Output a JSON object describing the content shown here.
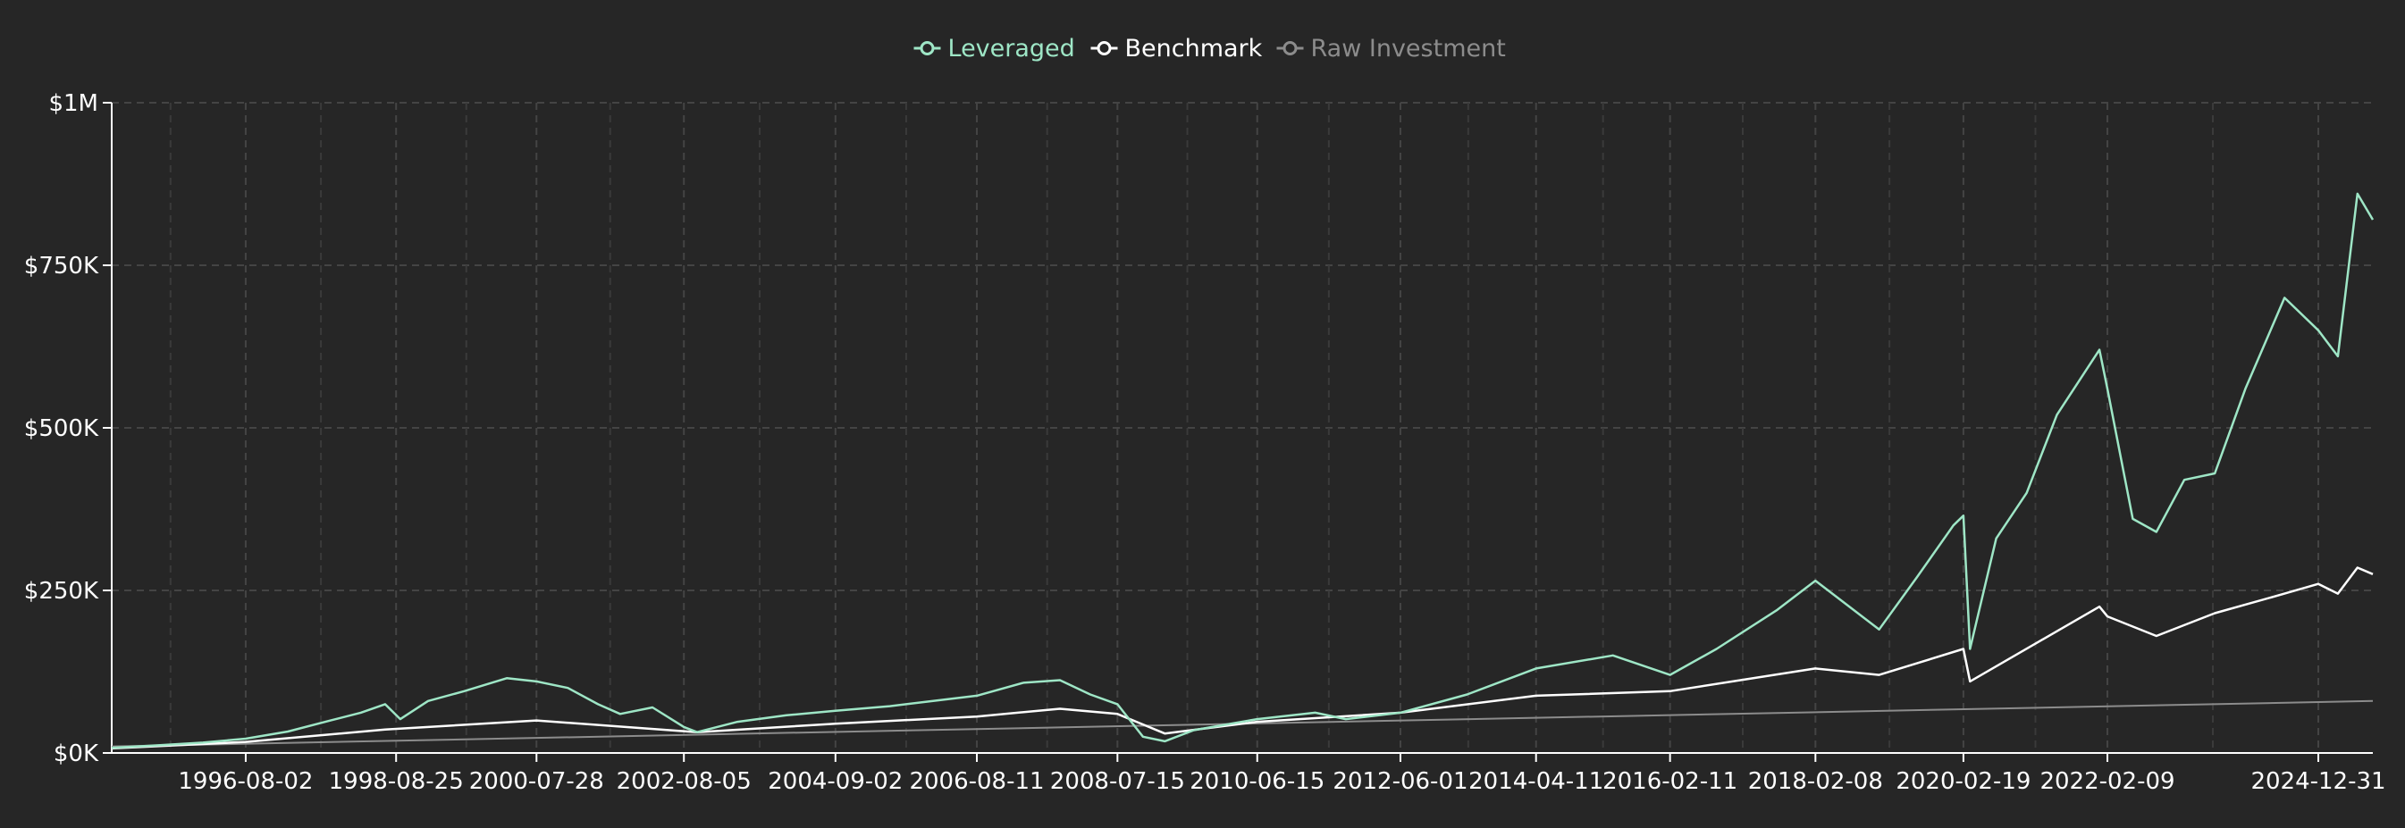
{
  "chart_data": {
    "type": "line",
    "title": "",
    "xlabel": "",
    "ylabel": "",
    "ylim": [
      0,
      1000000
    ],
    "grid": true,
    "legend_position": "top-center",
    "x_range": [
      "1994-10-01",
      "2025-09-30"
    ],
    "x_tick_labels": [
      "1996-08-02",
      "1998-08-25",
      "2000-07-28",
      "2002-08-05",
      "2004-09-02",
      "2006-08-11",
      "2008-07-15",
      "2010-06-15",
      "2012-06-01",
      "2014-04-11",
      "2016-02-11",
      "2018-02-08",
      "2020-02-19",
      "2022-02-09",
      "2024-12-31"
    ],
    "y_ticks": [
      {
        "value": 0,
        "label": "$0K"
      },
      {
        "value": 250000,
        "label": "$250K"
      },
      {
        "value": 500000,
        "label": "$500K"
      },
      {
        "value": 750000,
        "label": "$750K"
      },
      {
        "value": 1000000,
        "label": "$1M"
      }
    ],
    "series": [
      {
        "name": "Leveraged",
        "color": "#9ee6c6",
        "points": [
          [
            "1994-10-01",
            8000
          ],
          [
            "1995-06-01",
            12000
          ],
          [
            "1996-01-01",
            16000
          ],
          [
            "1996-08-02",
            22000
          ],
          [
            "1997-03-01",
            33000
          ],
          [
            "1997-10-01",
            50000
          ],
          [
            "1998-03-01",
            62000
          ],
          [
            "1998-07-01",
            75000
          ],
          [
            "1998-09-15",
            52000
          ],
          [
            "1999-02-01",
            80000
          ],
          [
            "1999-08-01",
            95000
          ],
          [
            "2000-03-01",
            115000
          ],
          [
            "2000-07-28",
            110000
          ],
          [
            "2001-01-01",
            100000
          ],
          [
            "2001-06-01",
            75000
          ],
          [
            "2001-09-20",
            60000
          ],
          [
            "2002-03-01",
            70000
          ],
          [
            "2002-08-05",
            40000
          ],
          [
            "2002-10-10",
            32000
          ],
          [
            "2003-05-01",
            48000
          ],
          [
            "2004-01-01",
            58000
          ],
          [
            "2004-09-02",
            65000
          ],
          [
            "2005-06-01",
            72000
          ],
          [
            "2006-03-01",
            82000
          ],
          [
            "2006-08-11",
            88000
          ],
          [
            "2007-04-01",
            108000
          ],
          [
            "2007-10-01",
            112000
          ],
          [
            "2008-03-01",
            90000
          ],
          [
            "2008-07-15",
            75000
          ],
          [
            "2008-11-20",
            25000
          ],
          [
            "2009-03-09",
            18000
          ],
          [
            "2009-08-01",
            35000
          ],
          [
            "2010-06-15",
            52000
          ],
          [
            "2011-04-01",
            62000
          ],
          [
            "2011-09-01",
            52000
          ],
          [
            "2012-06-01",
            62000
          ],
          [
            "2013-05-01",
            90000
          ],
          [
            "2014-04-11",
            130000
          ],
          [
            "2015-05-01",
            150000
          ],
          [
            "2016-02-11",
            120000
          ],
          [
            "2016-10-01",
            160000
          ],
          [
            "2017-08-01",
            220000
          ],
          [
            "2018-02-08",
            265000
          ],
          [
            "2018-12-24",
            190000
          ],
          [
            "2019-07-01",
            270000
          ],
          [
            "2019-12-31",
            350000
          ],
          [
            "2020-02-19",
            365000
          ],
          [
            "2020-03-23",
            160000
          ],
          [
            "2020-08-01",
            330000
          ],
          [
            "2021-01-01",
            400000
          ],
          [
            "2021-06-01",
            520000
          ],
          [
            "2021-12-31",
            620000
          ],
          [
            "2022-02-09",
            560000
          ],
          [
            "2022-06-16",
            360000
          ],
          [
            "2022-10-12",
            340000
          ],
          [
            "2023-03-01",
            420000
          ],
          [
            "2023-08-01",
            430000
          ],
          [
            "2024-01-01",
            560000
          ],
          [
            "2024-07-15",
            700000
          ],
          [
            "2024-12-31",
            650000
          ],
          [
            "2025-04-08",
            610000
          ],
          [
            "2025-07-15",
            860000
          ],
          [
            "2025-09-30",
            820000
          ]
        ]
      },
      {
        "name": "Benchmark",
        "color": "#ffffff",
        "points": [
          [
            "1994-10-01",
            7000
          ],
          [
            "1996-08-02",
            17000
          ],
          [
            "1998-07-01",
            36000
          ],
          [
            "2000-07-28",
            50000
          ],
          [
            "2002-10-10",
            32000
          ],
          [
            "2004-09-02",
            45000
          ],
          [
            "2006-08-11",
            56000
          ],
          [
            "2007-10-01",
            68000
          ],
          [
            "2008-07-15",
            60000
          ],
          [
            "2009-03-09",
            30000
          ],
          [
            "2010-06-15",
            48000
          ],
          [
            "2012-06-01",
            62000
          ],
          [
            "2014-04-11",
            88000
          ],
          [
            "2016-02-11",
            95000
          ],
          [
            "2018-02-08",
            130000
          ],
          [
            "2018-12-24",
            120000
          ],
          [
            "2020-02-19",
            160000
          ],
          [
            "2020-03-23",
            110000
          ],
          [
            "2021-12-31",
            225000
          ],
          [
            "2022-02-09",
            210000
          ],
          [
            "2022-10-12",
            180000
          ],
          [
            "2023-08-01",
            215000
          ],
          [
            "2024-07-15",
            245000
          ],
          [
            "2024-12-31",
            260000
          ],
          [
            "2025-04-08",
            245000
          ],
          [
            "2025-07-15",
            285000
          ],
          [
            "2025-09-30",
            275000
          ]
        ]
      },
      {
        "name": "Raw Investment",
        "color": "#8c8c8c",
        "points": [
          [
            "1994-10-01",
            10000
          ],
          [
            "2025-09-30",
            80000
          ]
        ]
      }
    ]
  }
}
